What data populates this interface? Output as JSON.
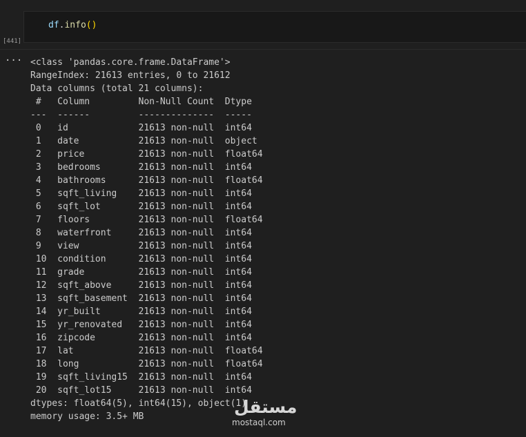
{
  "cell": {
    "code": {
      "var": "df",
      "dot": ".",
      "fn": "info",
      "parens": "()"
    },
    "exec_count": "[441]",
    "output_menu": "···"
  },
  "output": {
    "lines": [
      "<class 'pandas.core.frame.DataFrame'>",
      "RangeIndex: 21613 entries, 0 to 21612",
      "Data columns (total 21 columns):",
      " #   Column         Non-Null Count  Dtype  ",
      "---  ------         --------------  -----  ",
      " 0   id             21613 non-null  int64  ",
      " 1   date           21613 non-null  object ",
      " 2   price          21613 non-null  float64",
      " 3   bedrooms       21613 non-null  int64  ",
      " 4   bathrooms      21613 non-null  float64",
      " 5   sqft_living    21613 non-null  int64  ",
      " 6   sqft_lot       21613 non-null  int64  ",
      " 7   floors         21613 non-null  float64",
      " 8   waterfront     21613 non-null  int64  ",
      " 9   view           21613 non-null  int64  ",
      " 10  condition      21613 non-null  int64  ",
      " 11  grade          21613 non-null  int64  ",
      " 12  sqft_above     21613 non-null  int64  ",
      " 13  sqft_basement  21613 non-null  int64  ",
      " 14  yr_built       21613 non-null  int64  ",
      " 15  yr_renovated   21613 non-null  int64  ",
      " 16  zipcode        21613 non-null  int64  ",
      " 17  lat            21613 non-null  float64",
      " 18  long           21613 non-null  float64",
      " 19  sqft_living15  21613 non-null  int64  ",
      " 20  sqft_lot15     21613 non-null  int64  ",
      "dtypes: float64(5), int64(15), object(1)",
      "memory usage: 3.5+ MB"
    ]
  },
  "watermark": {
    "word": "مستقل",
    "url": "mostaql.com"
  },
  "colors": {
    "background": "#1f1f1f",
    "cell_background": "#181818",
    "text": "#cccccc",
    "code_variable": "#9cdcfe",
    "code_function": "#dcdcaa",
    "code_paren": "#ffd700"
  }
}
